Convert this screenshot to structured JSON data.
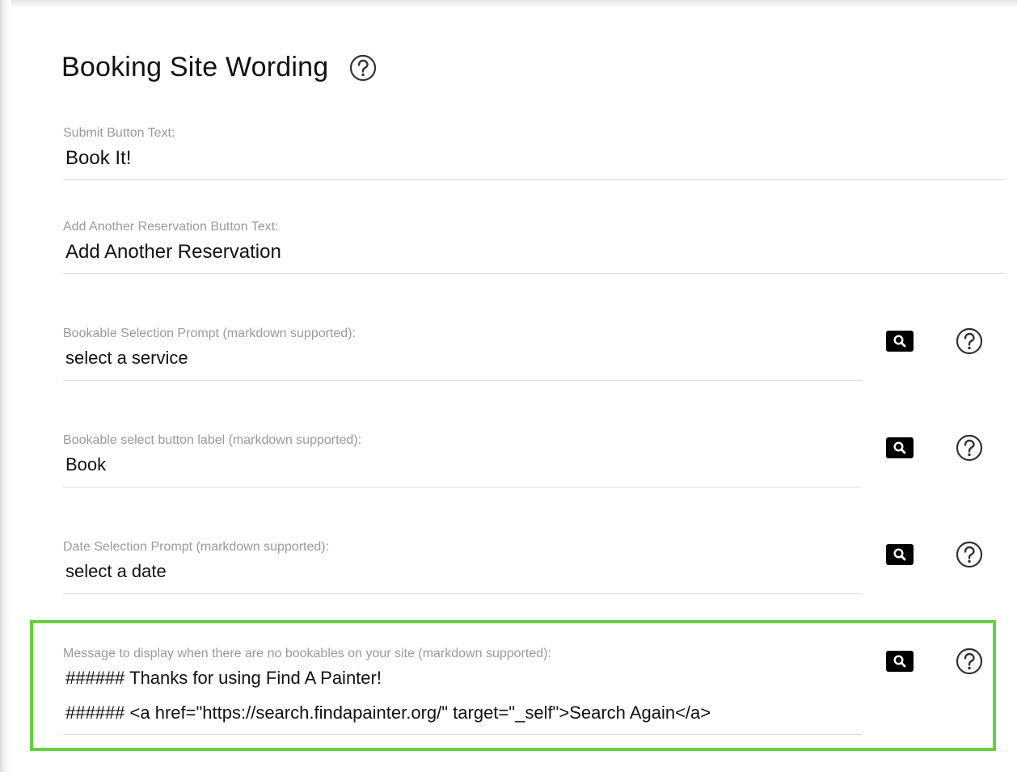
{
  "section": {
    "title": "Booking Site Wording"
  },
  "fields": [
    {
      "label": "Submit Button Text:",
      "value": "Book It!"
    },
    {
      "label": "Add Another Reservation Button Text:",
      "value": "Add Another Reservation"
    },
    {
      "label": "Bookable Selection Prompt (markdown supported):",
      "value": "select a service"
    },
    {
      "label": "Bookable select button label (markdown supported):",
      "value": "Book"
    },
    {
      "label": "Date Selection Prompt (markdown supported):",
      "value": "select a date"
    },
    {
      "label": "Message to display when there are no bookables on your site (markdown supported):",
      "line1": "###### Thanks for using Find A Painter!",
      "line2": "###### <a href=\"https://search.findapainter.org/\" target=\"_self\">Search Again</a>"
    }
  ],
  "icons": {
    "help": "help-circle-icon",
    "preview": "magnifier-icon"
  },
  "colors": {
    "highlight": "#66d13f",
    "label": "#9a9a9a",
    "divider": "#dcdcdc"
  }
}
